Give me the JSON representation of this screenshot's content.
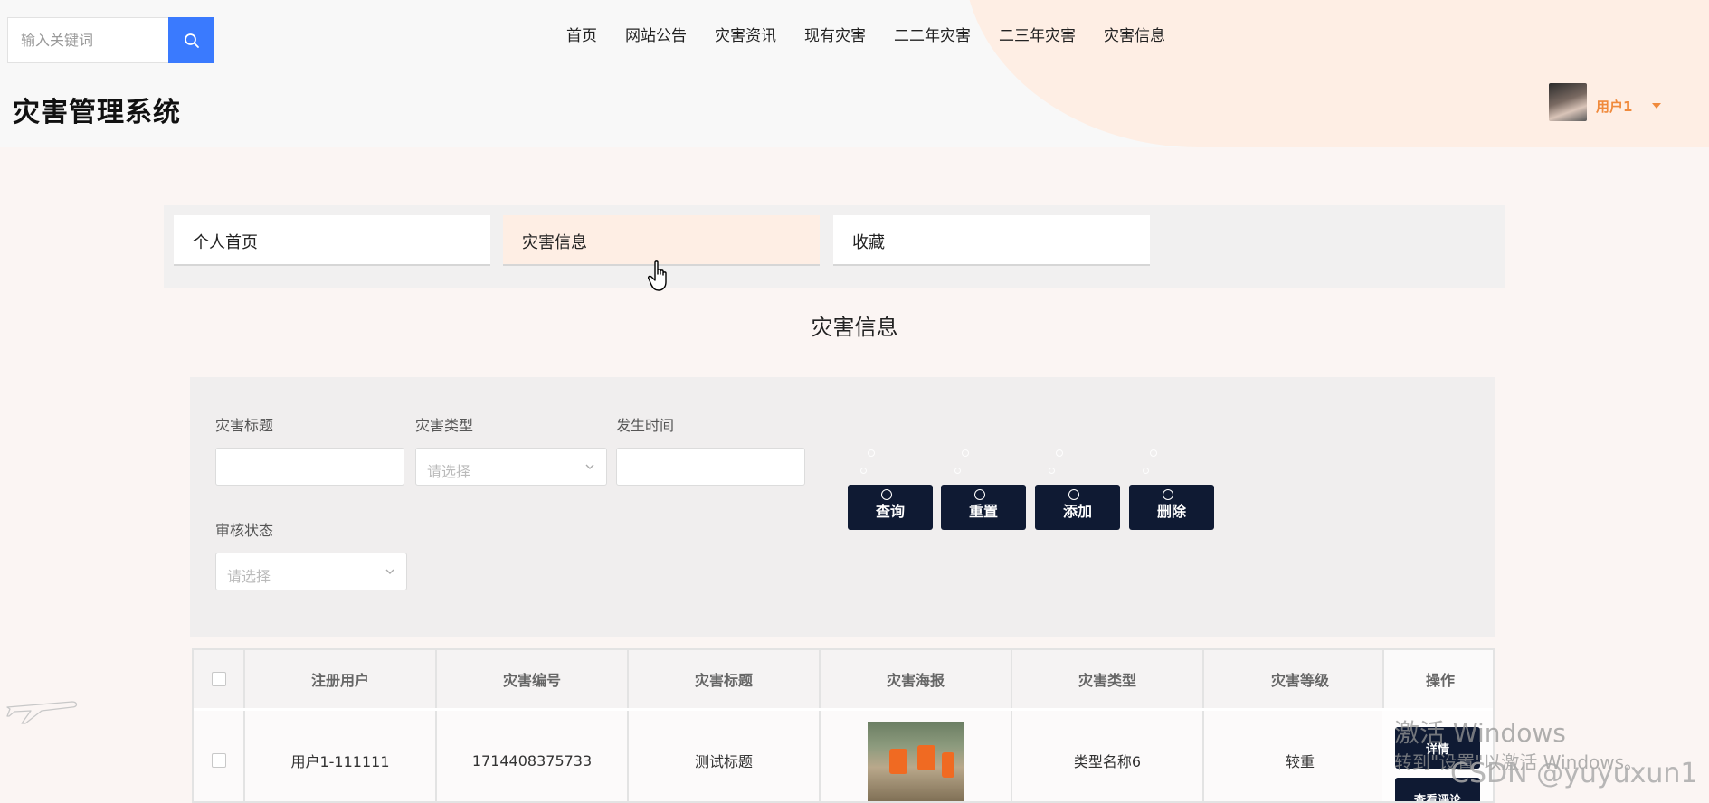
{
  "header": {
    "search_placeholder": "输入关键词",
    "site_title": "灾害管理系统",
    "nav": [
      "首页",
      "网站公告",
      "灾害资讯",
      "现有灾害",
      "二二年灾害",
      "二三年灾害",
      "灾害信息"
    ],
    "user_name": "用户1"
  },
  "tabs": [
    "个人首页",
    "灾害信息",
    "收藏"
  ],
  "active_tab": "灾害信息",
  "page_title": "灾害信息",
  "filter": {
    "title_label": "灾害标题",
    "type_label": "灾害类型",
    "type_placeholder": "请选择",
    "time_label": "发生时间",
    "status_label": "审核状态",
    "status_placeholder": "请选择",
    "buttons": [
      "查询",
      "重置",
      "添加",
      "删除"
    ]
  },
  "table": {
    "headers": [
      "注册用户",
      "灾害编号",
      "灾害标题",
      "灾害海报",
      "灾害类型",
      "灾害等级",
      "操作"
    ],
    "row": {
      "user": "用户1-111111",
      "code": "1714408375733",
      "title": "测试标题",
      "type": "类型名称6",
      "level": "较重",
      "op_detail": "详情",
      "op_comment": "查看评论"
    }
  },
  "watermark": {
    "line1": "激活 Windows",
    "line2": "转到\"设置\"以激活 Windows。",
    "csdn": "CSDN @yuyuxun1"
  },
  "colors": {
    "accent_blue": "#3a7afe",
    "button_dark": "#0f1a33",
    "user_orange": "#f08a3c",
    "active_tab_bg": "#feeee4"
  }
}
